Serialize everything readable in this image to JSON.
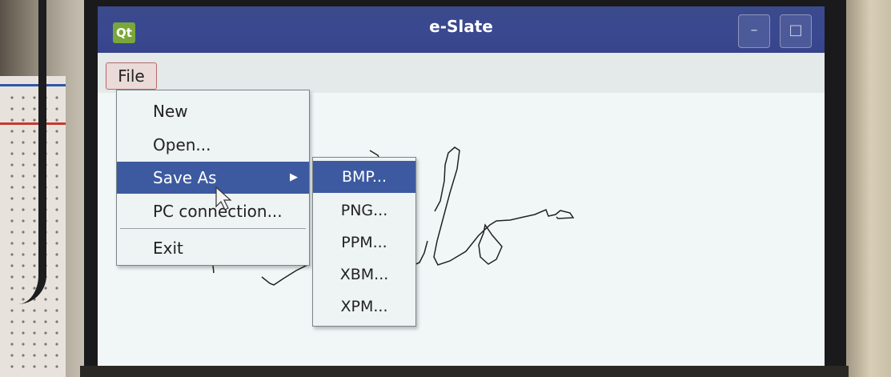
{
  "window": {
    "title": "e-Slate",
    "app_icon_text": "Qt",
    "minimize_glyph": "–",
    "maximize_glyph": "□"
  },
  "menubar": {
    "file_label": "File"
  },
  "file_menu": {
    "items": [
      {
        "label": "New"
      },
      {
        "label": "Open..."
      },
      {
        "label": "Save As",
        "arrow": "▶"
      },
      {
        "label": "PC connection..."
      },
      {
        "label": "Exit"
      }
    ]
  },
  "save_as_submenu": {
    "items": [
      {
        "label": "BMP..."
      },
      {
        "label": "PNG..."
      },
      {
        "label": "PPM..."
      },
      {
        "label": "XBM..."
      },
      {
        "label": "XPM..."
      }
    ]
  },
  "colors": {
    "titlebar": "#3a4891",
    "highlight": "#3d5aa0",
    "canvas": "#f1f7f7",
    "menu_bg": "#eef3f4"
  }
}
